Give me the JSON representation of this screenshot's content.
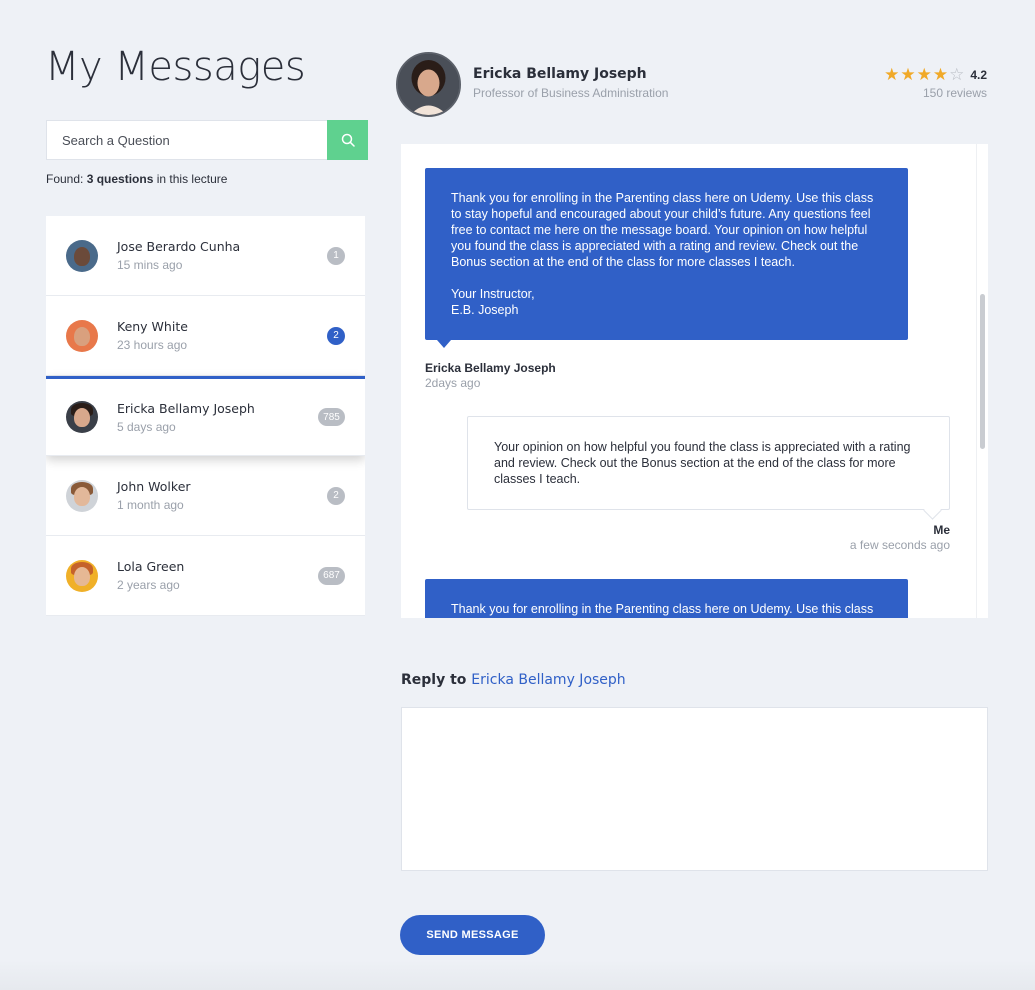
{
  "page": {
    "title": "My Messages"
  },
  "search": {
    "placeholder": "Search a Question"
  },
  "found": {
    "prefix": "Found:",
    "count": "3 questions",
    "suffix": "in this lecture"
  },
  "threads": [
    {
      "name": "Jose Berardo Cunha",
      "time": "15 mins ago",
      "count": "1",
      "active": false,
      "unread": false
    },
    {
      "name": "Keny White",
      "time": "23 hours ago",
      "count": "2",
      "active": false,
      "unread": true
    },
    {
      "name": "Ericka Bellamy Joseph",
      "time": "5 days ago",
      "count": "785",
      "active": true,
      "unread": false
    },
    {
      "name": "John Wolker",
      "time": "1 month ago",
      "count": "2",
      "active": false,
      "unread": false
    },
    {
      "name": "Lola Green",
      "time": "2 years ago",
      "count": "687",
      "active": false,
      "unread": false
    }
  ],
  "profile": {
    "name": "Ericka Bellamy Joseph",
    "role": "Professor of Business Administration",
    "rating": "4.2",
    "reviews": "150 reviews",
    "stars_filled": 4,
    "stars_total": 5
  },
  "messages": [
    {
      "text": "Thank you for enrolling in the Parenting class here on Udemy. Use this class to stay hopeful and encouraged about your child’s future. Any questions feel free to contact me here on the message board. Your opinion on how helpful you found the class is appreciated with a rating and review. Check out the Bonus section at the end of the class for more classes I teach.\n\nYour Instructor,\nE.B. Joseph",
      "sender": "Ericka Bellamy Joseph",
      "time": "2days ago"
    },
    {
      "text": "Your opinion on how helpful you found the class is appreciated with a rating and review. Check out the Bonus section at the end of the class for more classes I teach.",
      "sender": "Me",
      "time": "a few seconds ago"
    },
    {
      "text": "Thank you for enrolling in the Parenting class here on Udemy. Use this class"
    }
  ],
  "reply": {
    "label": "Reply to",
    "recipient": "Ericka Bellamy Joseph"
  },
  "send_button": "SEND MESSAGE",
  "colors": {
    "accent": "#3060c7",
    "search_button": "#5fd18f",
    "star": "#f0a928",
    "background": "#eef1f6"
  }
}
